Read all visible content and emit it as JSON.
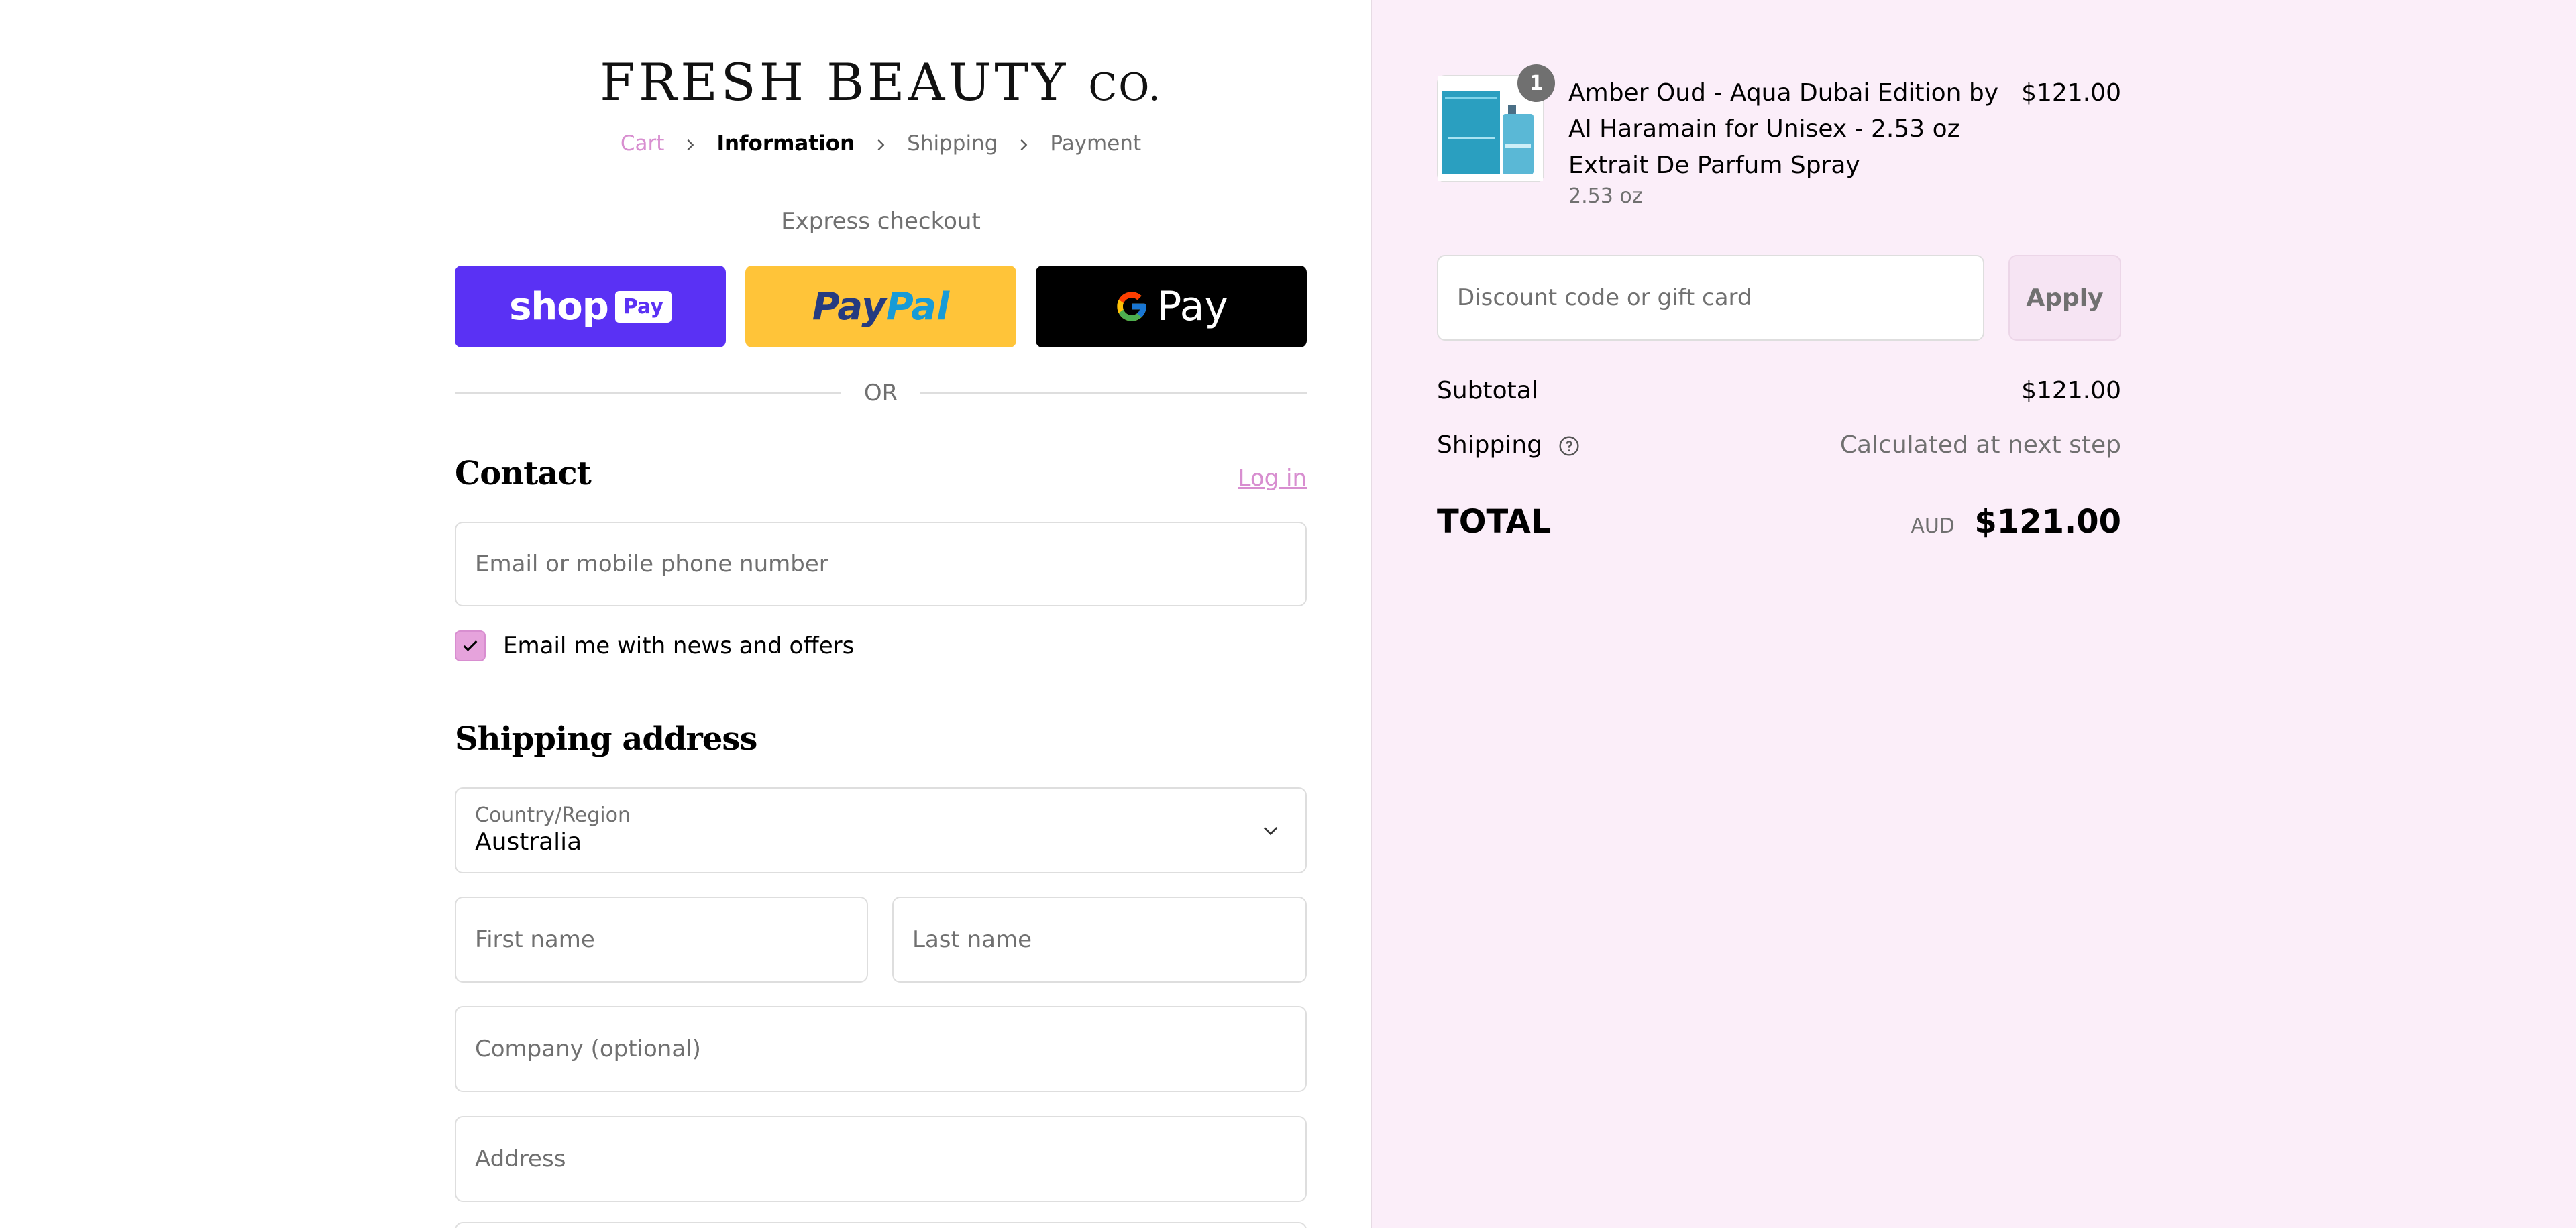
{
  "store": {
    "name": "FRESH BEAUTY",
    "suffix": "CO."
  },
  "breadcrumb": {
    "cart": "Cart",
    "information": "Information",
    "shipping": "Shipping",
    "payment": "Payment"
  },
  "express": {
    "label": "Express checkout",
    "shop_pay": {
      "text": "shop",
      "box": "Pay"
    },
    "paypal": {
      "part1": "Pay",
      "part2": "Pal"
    },
    "gpay": {
      "text": "Pay"
    },
    "or": "OR"
  },
  "contact": {
    "title": "Contact",
    "login": "Log in",
    "email_placeholder": "Email or mobile phone number",
    "newsletter_label": "Email me with news and offers",
    "newsletter_checked": true
  },
  "shipping_address": {
    "title": "Shipping address",
    "country_label": "Country/Region",
    "country_value": "Australia",
    "first_name_placeholder": "First name",
    "last_name_placeholder": "Last name",
    "company_placeholder": "Company (optional)",
    "address_placeholder": "Address"
  },
  "order": {
    "item": {
      "quantity": "1",
      "name": "Amber Oud - Aqua Dubai Edition by Al Haramain for Unisex - 2.53 oz Extrait De Parfum Spray",
      "variant": "2.53 oz",
      "price": "$121.00"
    },
    "discount_placeholder": "Discount code or gift card",
    "apply": "Apply",
    "subtotal_label": "Subtotal",
    "subtotal_value": "$121.00",
    "shipping_label": "Shipping",
    "shipping_value": "Calculated at next step",
    "total_label": "TOTAL",
    "total_currency": "AUD",
    "total_value": "$121.00"
  },
  "colors": {
    "accent": "#d88ed0",
    "shop_pay": "#5a31f4",
    "paypal": "#ffc439",
    "panel_bg": "#fbeef9"
  }
}
